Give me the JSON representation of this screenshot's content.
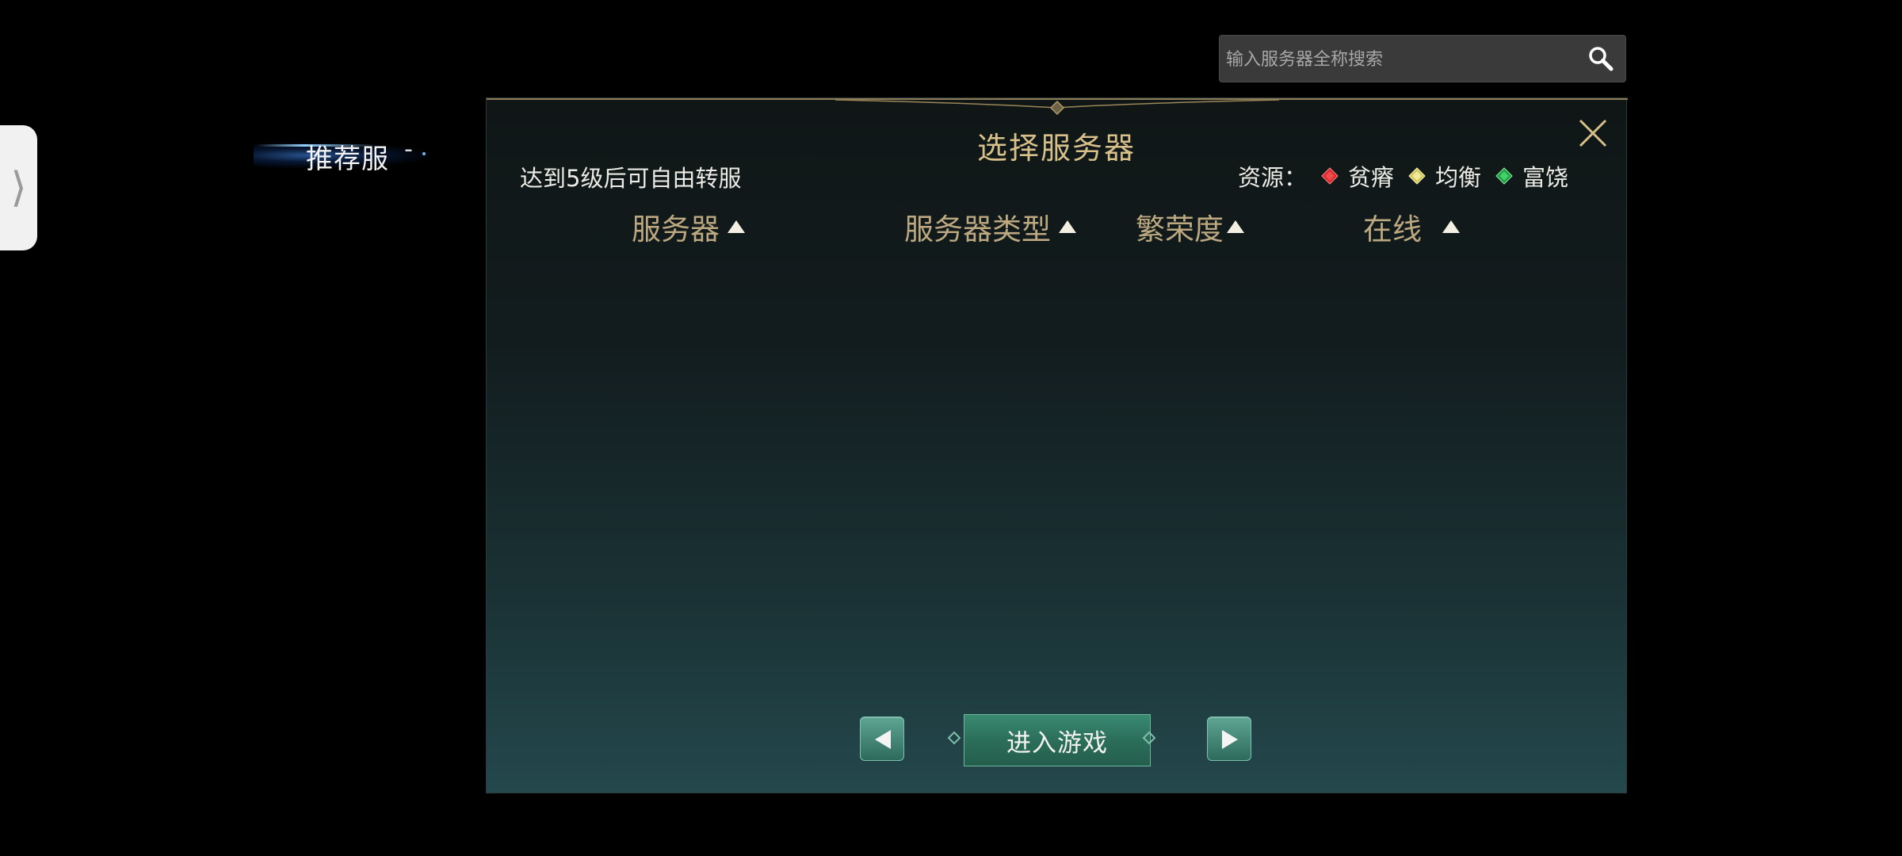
{
  "drawer": {
    "handle_glyph": "⟩",
    "icon": "chevron-right-icon"
  },
  "recommended_tab": {
    "label": "推荐服",
    "dash": "-"
  },
  "search": {
    "placeholder": "输入服务器全称搜索",
    "value": "",
    "icon": "search-icon"
  },
  "panel": {
    "title": "选择服务器",
    "transfer_note": "达到5级后可自由转服",
    "close_icon": "close-icon"
  },
  "legend": {
    "title": "资源：",
    "items": [
      {
        "label": "贫瘠",
        "color": "#d8262c"
      },
      {
        "label": "均衡",
        "color": "#e8e07a"
      },
      {
        "label": "富饶",
        "color": "#2fbf55"
      }
    ]
  },
  "columns": [
    {
      "label": "服务器"
    },
    {
      "label": "服务器类型"
    },
    {
      "label": "繁荣度"
    },
    {
      "label": "在线"
    }
  ],
  "controls": {
    "prev_icon": "triangle-left-icon",
    "next_icon": "triangle-right-icon",
    "enter_label": "进入游戏"
  },
  "colors": {
    "title_gold": "#d8c08a",
    "header_gold": "#bda981",
    "button_teal": "#2b6e5a"
  }
}
